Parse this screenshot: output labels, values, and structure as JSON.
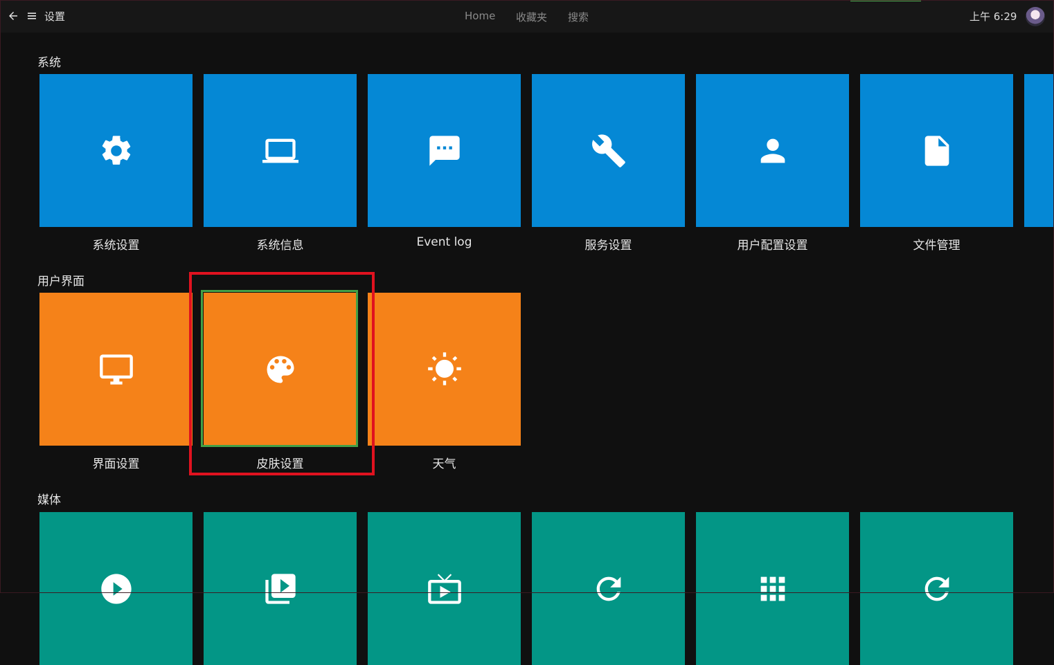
{
  "header": {
    "title": "设置",
    "nav": [
      "Home",
      "收藏夹",
      "搜索"
    ],
    "clock": "上午 6:29"
  },
  "sections": [
    {
      "title": "系统",
      "tiles": [
        {
          "label": "系统设置",
          "icon": "gear-icon"
        },
        {
          "label": "系统信息",
          "icon": "laptop-icon"
        },
        {
          "label": "Event log",
          "icon": "chat-bubble-icon"
        },
        {
          "label": "服务设置",
          "icon": "wrench-icon"
        },
        {
          "label": "用户配置设置",
          "icon": "person-icon"
        },
        {
          "label": "文件管理",
          "icon": "file-icon"
        }
      ]
    },
    {
      "title": "用户界面",
      "tiles": [
        {
          "label": "界面设置",
          "icon": "monitor-icon"
        },
        {
          "label": "皮肤设置",
          "icon": "palette-icon"
        },
        {
          "label": "天气",
          "icon": "sun-icon"
        }
      ]
    },
    {
      "title": "媒体",
      "tiles": [
        {
          "icon": "play-circle-icon"
        },
        {
          "icon": "playlist-icon"
        },
        {
          "icon": "tv-icon"
        },
        {
          "icon": "refresh-icon"
        },
        {
          "icon": "grid-icon"
        },
        {
          "icon": "refresh-icon"
        }
      ]
    }
  ],
  "colors": {
    "system": "#0588d5",
    "interface": "#f58219",
    "media": "#039686",
    "focus": "#43a047",
    "highlight": "#e0121f"
  }
}
